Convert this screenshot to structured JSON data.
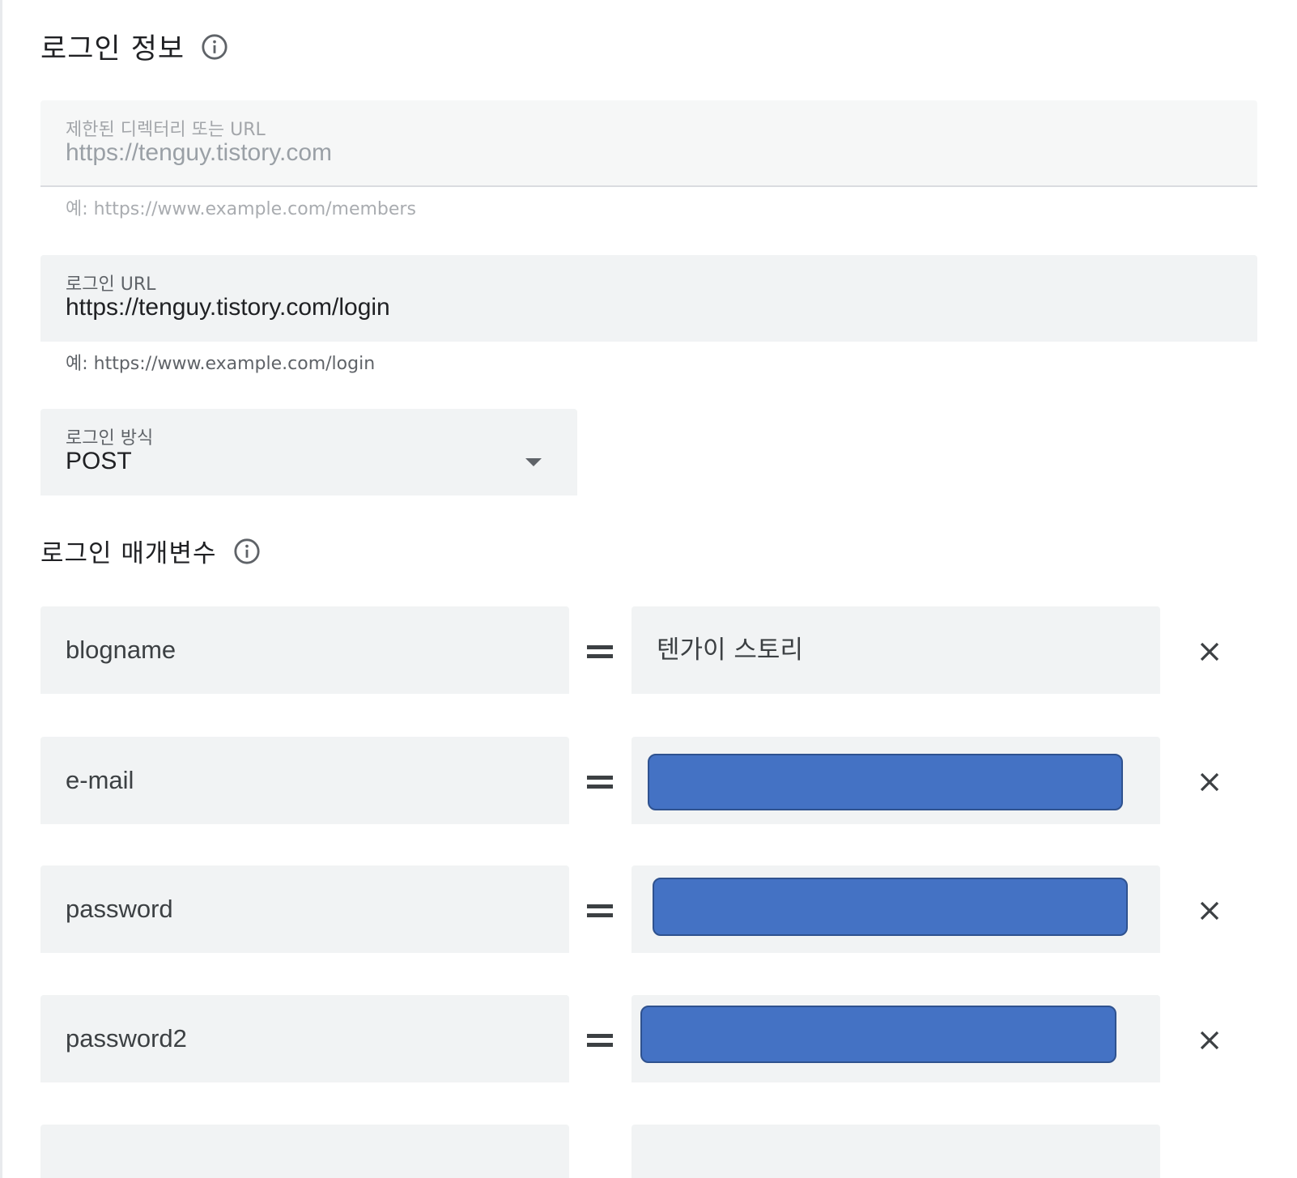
{
  "login_info": {
    "title": "로그인 정보",
    "restricted_field": {
      "label": "제한된 디렉터리 또는 URL",
      "value": "https://tenguy.tistory.com",
      "helper": "예: https://www.example.com/members"
    },
    "login_url_field": {
      "label": "로그인 URL",
      "value": "https://tenguy.tistory.com/login",
      "helper": "예: https://www.example.com/login"
    },
    "login_method": {
      "label": "로그인 방식",
      "selected": "POST"
    }
  },
  "login_params": {
    "title": "로그인 매개변수",
    "rows": [
      {
        "key": "blogname",
        "value": "텐가이 스토리",
        "redacted": false
      },
      {
        "key": "e-mail",
        "value": "",
        "redacted": true
      },
      {
        "key": "password",
        "value": "",
        "redacted": true
      },
      {
        "key": "password2",
        "value": "",
        "redacted": true
      },
      {
        "key": "",
        "value": "",
        "redacted": false
      }
    ]
  },
  "colors": {
    "field_bg": "#f1f3f4",
    "redaction": "#4472c4",
    "text_primary": "#202124",
    "text_secondary": "#5f6368"
  }
}
